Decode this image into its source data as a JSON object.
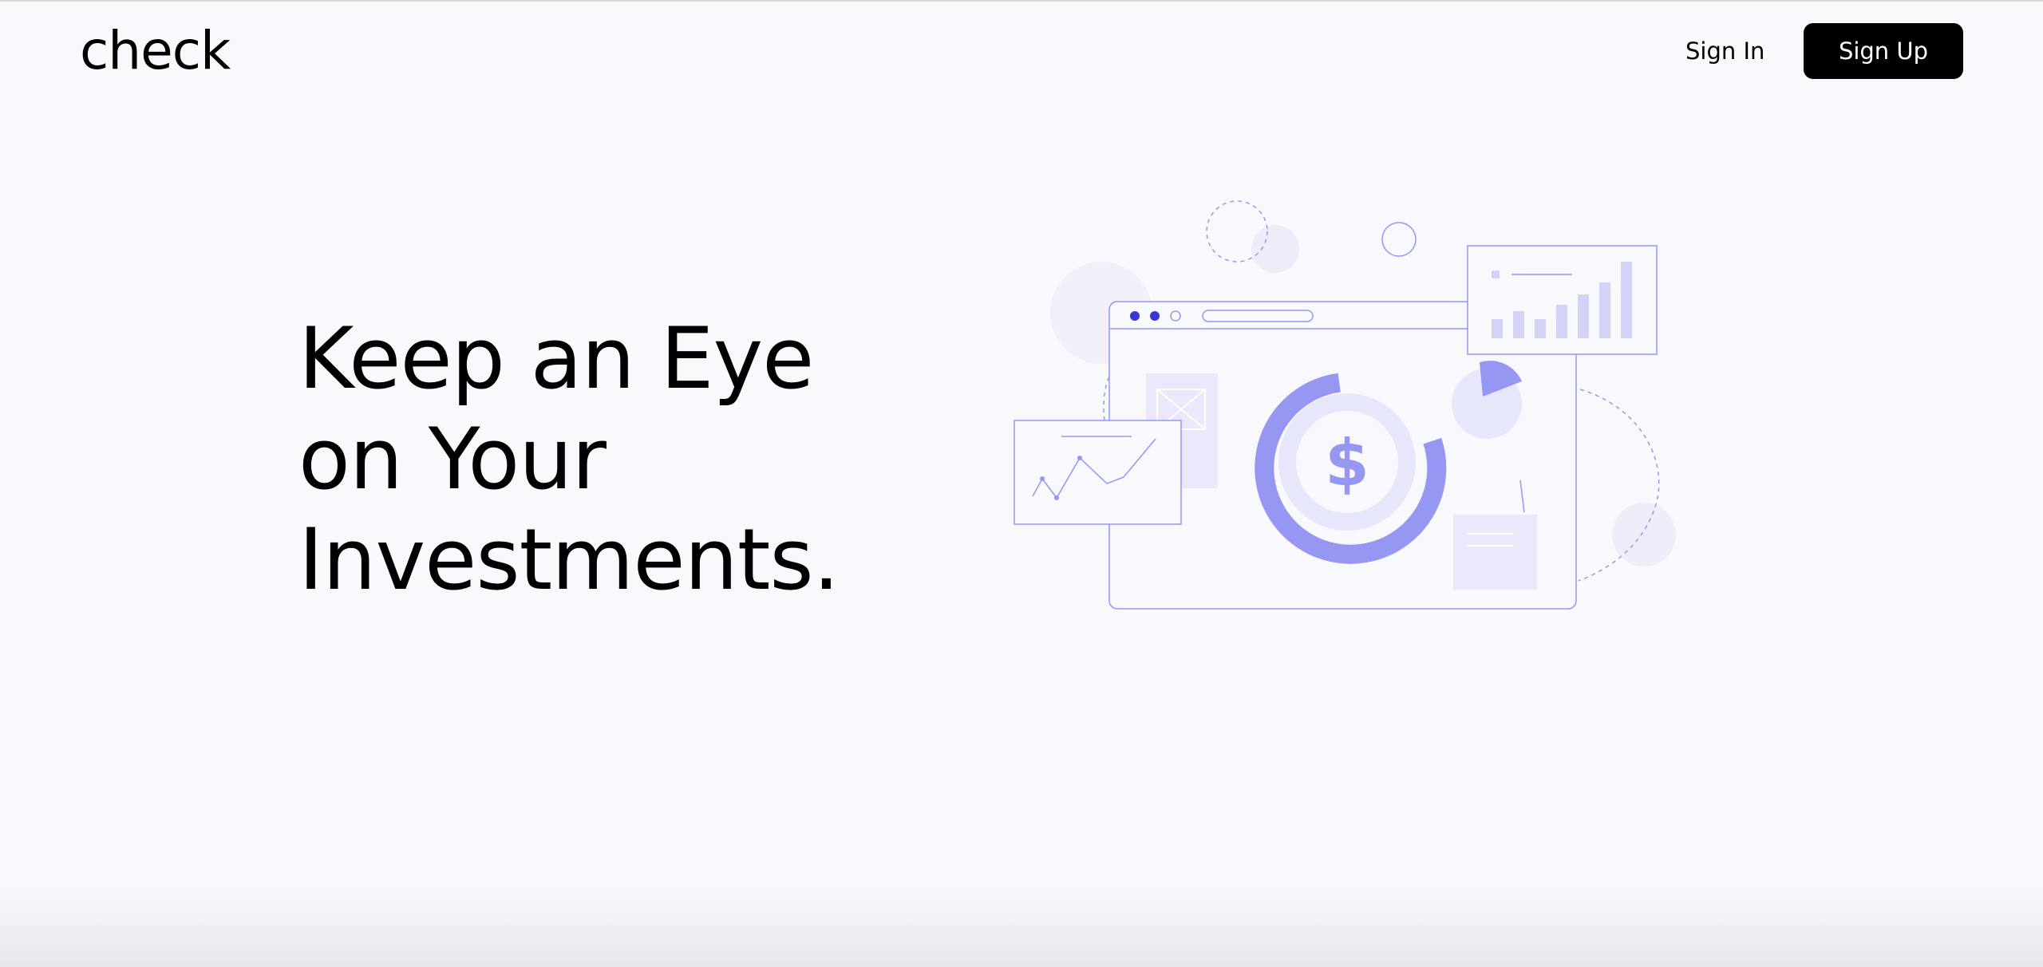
{
  "brand": {
    "logo_text": "check"
  },
  "nav": {
    "sign_in_label": "Sign In",
    "sign_up_label": "Sign Up"
  },
  "hero": {
    "title_lines": [
      "Keep an Eye",
      "on Your",
      "Investments."
    ]
  },
  "illustration": {
    "icon": "finance-dashboard-illustration",
    "currency_symbol": "$"
  },
  "colors": {
    "background": "#f8f9fc",
    "primary_text": "#000000",
    "button_bg": "#000000",
    "button_text": "#ffffff",
    "accent": "#9597f3",
    "accent_light": "#e7e7fb",
    "accent_dark": "#3b37d6"
  }
}
